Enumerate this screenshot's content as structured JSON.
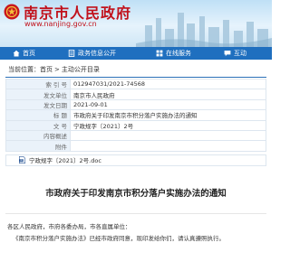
{
  "header": {
    "title": "南京市人民政府",
    "url": "www.nanjing.gov.cn"
  },
  "nav": {
    "items": [
      {
        "label": "首页",
        "icon": "home-icon"
      },
      {
        "label": "政务信息公开",
        "icon": "document-icon"
      },
      {
        "label": "在线服务",
        "icon": "grid-icon"
      },
      {
        "label": "互动",
        "icon": "chat-icon"
      }
    ]
  },
  "breadcrumb": {
    "prefix": "当前位置：",
    "home": "首页",
    "separator": ">",
    "current": "主动公开目录"
  },
  "info_table": {
    "rows": [
      {
        "label": "索 引 号",
        "value": "012947031/2021-74568"
      },
      {
        "label": "发文单位",
        "value": "南京市人民政府"
      },
      {
        "label": "发文日期",
        "value": "2021-09-01"
      },
      {
        "label": "标 题",
        "value": "市政府关于印发南京市积分落户实施办法的通知"
      },
      {
        "label": "文 号",
        "value": "宁政规字〔2021〕2号"
      },
      {
        "label": "内容概述",
        "value": ""
      },
      {
        "label": "附件",
        "value": ""
      }
    ]
  },
  "attachment": {
    "filename": "宁政规字〔2021〕2号.doc",
    "icon": "word-doc-icon"
  },
  "document": {
    "title": "市政府关于印发南京市积分落户实施办法的通知",
    "salutation": "各区人民政府，市府各委办局，市各直属单位：",
    "body": "《南京市积分落户实施办法》已经市政府同意，现印发给你们，请认真遵照执行。"
  },
  "colors": {
    "brand_red": "#c1121c",
    "nav_blue": "#1f6fbf",
    "label_bg": "#eaf2fa"
  }
}
